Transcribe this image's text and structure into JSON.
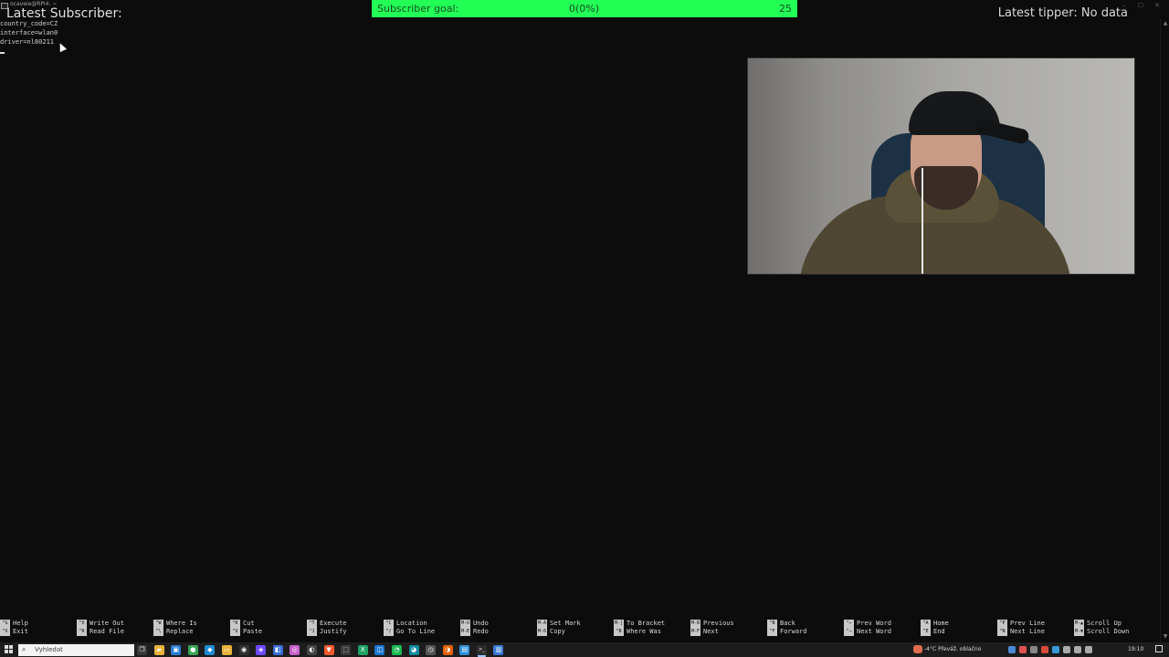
{
  "window": {
    "title": "ocaveie@RPi4: ~",
    "controls": [
      "–",
      "☐",
      "✕"
    ]
  },
  "terminal": {
    "lines": [
      "country_code=CZ",
      "interface=wlan0",
      "driver=nl80211"
    ]
  },
  "overlays": {
    "latest_subscriber": "Latest Subscriber:",
    "latest_tipper": "Latest tipper: No data",
    "subscriber_goal": {
      "label": "Subscriber goal:",
      "progress_text": "0(0%)",
      "target": "25",
      "progress": 0,
      "color": "#22ff55"
    }
  },
  "webcam": {
    "description_icon": "person-video-icon"
  },
  "nano_shortcuts": [
    {
      "top_key": "^G",
      "top_label": "Help",
      "bottom_key": "^X",
      "bottom_label": "Exit"
    },
    {
      "top_key": "^O",
      "top_label": "Write Out",
      "bottom_key": "^R",
      "bottom_label": "Read File"
    },
    {
      "top_key": "^W",
      "top_label": "Where Is",
      "bottom_key": "^\\",
      "bottom_label": "Replace"
    },
    {
      "top_key": "^K",
      "top_label": "Cut",
      "bottom_key": "^U",
      "bottom_label": "Paste"
    },
    {
      "top_key": "^T",
      "top_label": "Execute",
      "bottom_key": "^J",
      "bottom_label": "Justify"
    },
    {
      "top_key": "^C",
      "top_label": "Location",
      "bottom_key": "^/",
      "bottom_label": "Go To Line"
    },
    {
      "top_key": "M-U",
      "top_label": "Undo",
      "bottom_key": "M-E",
      "bottom_label": "Redo"
    },
    {
      "top_key": "M-A",
      "top_label": "Set Mark",
      "bottom_key": "M-6",
      "bottom_label": "Copy"
    },
    {
      "top_key": "M-]",
      "top_label": "To Bracket",
      "bottom_key": "^B",
      "bottom_label": "Where Was"
    },
    {
      "top_key": "M-B",
      "top_label": "Previous",
      "bottom_key": "M-F",
      "bottom_label": "Next"
    },
    {
      "top_key": "^B",
      "top_label": "Back",
      "bottom_key": "^F",
      "bottom_label": "Forward"
    },
    {
      "top_key": "^←",
      "top_label": "Prev Word",
      "bottom_key": "^→",
      "bottom_label": "Next Word"
    },
    {
      "top_key": "^A",
      "top_label": "Home",
      "bottom_key": "^E",
      "bottom_label": "End"
    },
    {
      "top_key": "^P",
      "top_label": "Prev Line",
      "bottom_key": "^N",
      "bottom_label": "Next Line"
    },
    {
      "top_key": "M-▲",
      "top_label": "Scroll Up",
      "bottom_key": "M-▼",
      "bottom_label": "Scroll Down"
    }
  ],
  "taskbar": {
    "search_placeholder": "Vyhledat",
    "apps": [
      {
        "icon": "task-view-icon",
        "color": "#3a3a3a",
        "glyph": "❐"
      },
      {
        "icon": "file-explorer-icon",
        "color": "#e8b33a",
        "glyph": "▰"
      },
      {
        "icon": "store-icon",
        "color": "#2b7cd3",
        "glyph": "▣"
      },
      {
        "icon": "chrome-icon",
        "color": "#3aa657",
        "glyph": "●"
      },
      {
        "icon": "vscode-icon",
        "color": "#1f8ad2",
        "glyph": "◆"
      },
      {
        "icon": "folder-icon",
        "color": "#e8b33a",
        "glyph": "▭"
      },
      {
        "icon": "obs-icon",
        "color": "#303030",
        "glyph": "◉"
      },
      {
        "icon": "proton-icon",
        "color": "#6d4aff",
        "glyph": "◈"
      },
      {
        "icon": "app-blue-icon",
        "color": "#3b6fd8",
        "glyph": "◧"
      },
      {
        "icon": "photo-icon",
        "color": "#c75ec9",
        "glyph": "◎"
      },
      {
        "icon": "github-icon",
        "color": "#444",
        "glyph": "◐"
      },
      {
        "icon": "brave-icon",
        "color": "#f55a2b",
        "glyph": "▼"
      },
      {
        "icon": "game-icon",
        "color": "#3b3b3b",
        "glyph": "⬚"
      },
      {
        "icon": "excel-icon",
        "color": "#21a366",
        "glyph": "X"
      },
      {
        "icon": "app-icon",
        "color": "#1b76d2",
        "glyph": "◫"
      },
      {
        "icon": "spotify-icon",
        "color": "#1db954",
        "glyph": "◔"
      },
      {
        "icon": "edge-icon",
        "color": "#0f8a9e",
        "glyph": "◕"
      },
      {
        "icon": "timer-icon",
        "color": "#555",
        "glyph": "◷"
      },
      {
        "icon": "firefox-icon",
        "color": "#e66000",
        "glyph": "◑"
      },
      {
        "icon": "shell-icon",
        "color": "#2f8fd8",
        "glyph": "▤"
      },
      {
        "icon": "terminal-icon",
        "color": "#2d2d2d",
        "glyph": ">_"
      },
      {
        "icon": "remote-icon",
        "color": "#3a7bd5",
        "glyph": "▥"
      }
    ],
    "active_app_index": 20,
    "weather": "-4°C  Převáž. oblačno",
    "clock": "19:10"
  }
}
